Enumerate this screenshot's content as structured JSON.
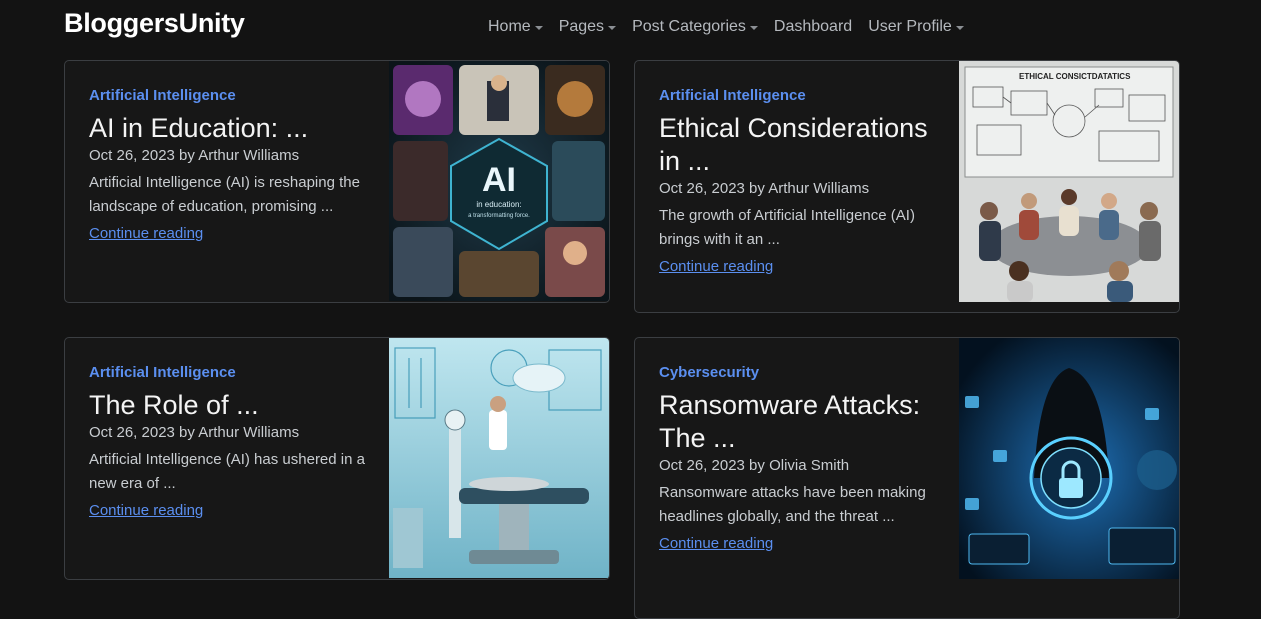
{
  "brand": "BloggersUnity",
  "nav": [
    {
      "label": "Home",
      "dropdown": true
    },
    {
      "label": "Pages",
      "dropdown": true
    },
    {
      "label": "Post Categories",
      "dropdown": true
    },
    {
      "label": "Dashboard",
      "dropdown": false
    },
    {
      "label": "User Profile",
      "dropdown": true
    }
  ],
  "posts": [
    {
      "category": "Artificial Intelligence",
      "title": "AI in Education: ...",
      "meta": "Oct 26, 2023 by Arthur Williams",
      "excerpt": "Artificial Intelligence (AI) is reshaping the landscape of education, promising ...",
      "link": "Continue reading",
      "image_text": [
        "AI",
        "in education:",
        "a transformatting force."
      ]
    },
    {
      "category": "Artificial Intelligence",
      "title": "Ethical Considerations in ...",
      "meta": "Oct 26, 2023 by Arthur Williams",
      "excerpt": "The growth of Artificial Intelligence (AI) brings with it an ...",
      "link": "Continue reading",
      "image_text": [
        "ETHICAL  CONSICTDATATICS"
      ]
    },
    {
      "category": "Artificial Intelligence",
      "title": "The Role of ...",
      "meta": "Oct 26, 2023 by Arthur Williams",
      "excerpt": "Artificial Intelligence (AI) has ushered in a new era of ...",
      "link": "Continue reading"
    },
    {
      "category": "Cybersecurity",
      "title": "Ransomware Attacks: The ...",
      "meta": "Oct 26, 2023 by Olivia Smith",
      "excerpt": "Ransomware attacks have been making headlines globally, and the threat ...",
      "link": "Continue reading"
    }
  ],
  "colors": {
    "background": "#131313",
    "accent": "#5b8ff0",
    "border": "#3b3e42"
  }
}
